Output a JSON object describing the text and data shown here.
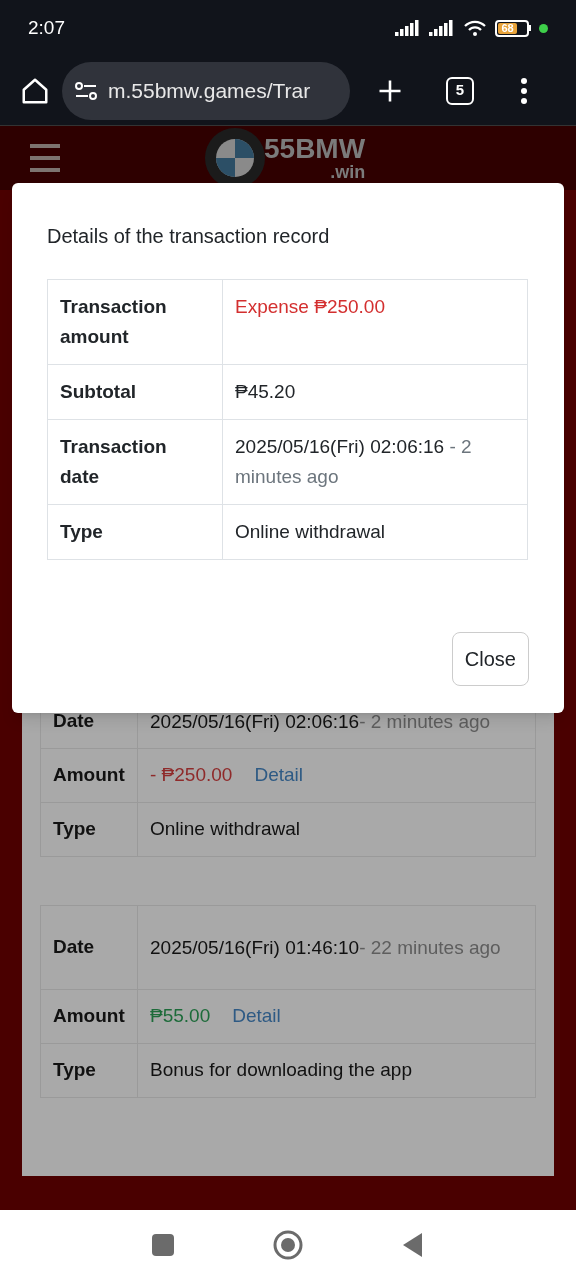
{
  "status_bar": {
    "time": "2:07",
    "battery": "68"
  },
  "browser": {
    "url": "m.55bmw.games/Trar",
    "tab_count": "5"
  },
  "site": {
    "logo_text": "55BMW",
    "logo_suffix": ".win"
  },
  "records": [
    {
      "date_label": "Date",
      "date": "2025/05/16(Fri) 02:06:16",
      "ago": "- 2 minutes ago",
      "amount_label": "Amount",
      "amount": {
        "value": "- ₱250.00",
        "kind": "expense"
      },
      "detail": "Detail",
      "type_label": "Type",
      "type": "Online withdrawal"
    },
    {
      "date_label": "Date",
      "date": "2025/05/16(Fri) 01:46:10",
      "ago": "- 22 minutes ago",
      "amount_label": "Amount",
      "amount": {
        "value": "₱55.00",
        "kind": "income"
      },
      "detail": "Detail",
      "type_label": "Type",
      "type": "Bonus for downloading the app"
    }
  ],
  "dialog": {
    "title": "Details of the transaction record",
    "rows": [
      {
        "label": "Transaction amount",
        "value": "Expense ₱250.00",
        "kind": "expense"
      },
      {
        "label": "Subtotal",
        "value": "₱45.20",
        "kind": "plain"
      },
      {
        "label": "Transaction date",
        "value": "2025/05/16(Fri) 02:06:16",
        "note": " - 2 minutes ago",
        "kind": "date"
      },
      {
        "label": "Type",
        "value": "Online withdrawal",
        "kind": "plain"
      }
    ],
    "close": "Close"
  }
}
